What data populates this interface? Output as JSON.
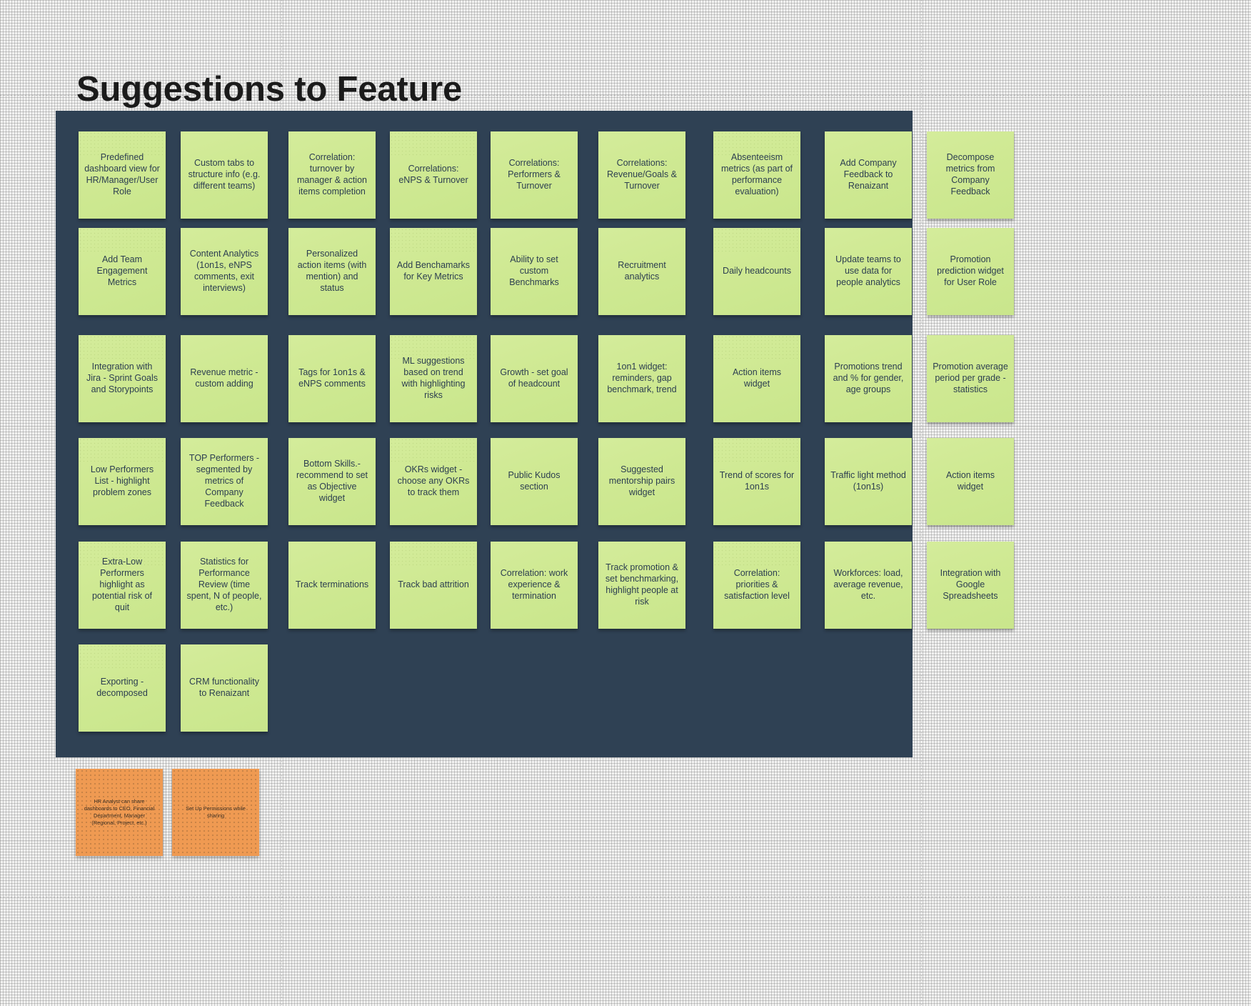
{
  "page": {
    "title": "Suggestions to Feature",
    "board_color": "#2f4154",
    "canvas_color": "#f2f2f1",
    "green_note_color": "#cde88e",
    "orange_note_color": "#ef9a52"
  },
  "board": {
    "columns": 9,
    "rows": 6,
    "notes": [
      {
        "text": "Predefined dashboard view for HR/Manager/User Role",
        "color": "green",
        "row": 1,
        "col": 1
      },
      {
        "text": "Custom tabs to structure info (e.g. different teams)",
        "color": "green",
        "row": 1,
        "col": 2
      },
      {
        "text": "Correlation: turnover by manager & action items completion",
        "color": "green",
        "row": 1,
        "col": 3
      },
      {
        "text": "Correlations: eNPS & Turnover",
        "color": "green",
        "row": 1,
        "col": 4
      },
      {
        "text": "Correlations: Performers & Turnover",
        "color": "green",
        "row": 1,
        "col": 5
      },
      {
        "text": "Correlations: Revenue/Goals & Turnover",
        "color": "green",
        "row": 1,
        "col": 6
      },
      {
        "text": "Absenteeism metrics (as part of performance evaluation)",
        "color": "green",
        "row": 1,
        "col": 7
      },
      {
        "text": "Add Company Feedback to Renaizant",
        "color": "green",
        "row": 1,
        "col": 8
      },
      {
        "text": "Decompose metrics from Company Feedback",
        "color": "green",
        "row": 1,
        "col": 9
      },
      {
        "text": "Add Team Engagement Metrics",
        "color": "green",
        "row": 2,
        "col": 1
      },
      {
        "text": "Content Analytics (1on1s, eNPS comments, exit interviews)",
        "color": "green",
        "row": 2,
        "col": 2
      },
      {
        "text": "Personalized action items (with mention) and status",
        "color": "green",
        "row": 2,
        "col": 3
      },
      {
        "text": "Add Benchamarks for Key Metrics",
        "color": "green",
        "row": 2,
        "col": 4
      },
      {
        "text": "Ability to set custom Benchmarks",
        "color": "green",
        "row": 2,
        "col": 5
      },
      {
        "text": "Recruitment analytics",
        "color": "green",
        "row": 2,
        "col": 6
      },
      {
        "text": "Daily headcounts",
        "color": "green",
        "row": 2,
        "col": 7
      },
      {
        "text": "Update teams to use data for people analytics",
        "color": "green",
        "row": 2,
        "col": 8
      },
      {
        "text": "Promotion prediction widget for User Role",
        "color": "green",
        "row": 2,
        "col": 9
      },
      {
        "text": "Integration with Jira - Sprint Goals and Storypoints",
        "color": "green",
        "row": 3,
        "col": 1
      },
      {
        "text": "Revenue metric - custom adding",
        "color": "green",
        "row": 3,
        "col": 2
      },
      {
        "text": "Tags for 1on1s & eNPS comments",
        "color": "green",
        "row": 3,
        "col": 3
      },
      {
        "text": "ML suggestions based on trend with highlighting risks",
        "color": "green",
        "row": 3,
        "col": 4
      },
      {
        "text": "Growth - set goal of headcount",
        "color": "green",
        "row": 3,
        "col": 5
      },
      {
        "text": "1on1 widget: reminders, gap benchmark, trend",
        "color": "green",
        "row": 3,
        "col": 6
      },
      {
        "text": "Action items widget",
        "color": "green",
        "row": 3,
        "col": 7
      },
      {
        "text": "Promotions trend and % for gender, age groups",
        "color": "green",
        "row": 3,
        "col": 8
      },
      {
        "text": "Promotion average period per grade - statistics",
        "color": "green",
        "row": 3,
        "col": 9
      },
      {
        "text": "Low Performers List - highlight problem zones",
        "color": "green",
        "row": 4,
        "col": 1
      },
      {
        "text": "TOP Performers - segmented by metrics of Company Feedback",
        "color": "green",
        "row": 4,
        "col": 2
      },
      {
        "text": "Bottom Skills.- recommend to set as Objective widget",
        "color": "green",
        "row": 4,
        "col": 3
      },
      {
        "text": "OKRs widget - choose any OKRs to track them",
        "color": "green",
        "row": 4,
        "col": 4
      },
      {
        "text": "Public Kudos section",
        "color": "green",
        "row": 4,
        "col": 5
      },
      {
        "text": "Suggested mentorship pairs widget",
        "color": "green",
        "row": 4,
        "col": 6
      },
      {
        "text": "Trend of scores for 1on1s",
        "color": "green",
        "row": 4,
        "col": 7
      },
      {
        "text": "Traffic light method (1on1s)",
        "color": "green",
        "row": 4,
        "col": 8
      },
      {
        "text": "Action items widget",
        "color": "green",
        "row": 4,
        "col": 9
      },
      {
        "text": "Extra-Low Performers highlight as potential risk of quit",
        "color": "green",
        "row": 5,
        "col": 1
      },
      {
        "text": "Statistics for Performance Review (time spent, N of people, etc.)",
        "color": "green",
        "row": 5,
        "col": 2
      },
      {
        "text": "Track terminations",
        "color": "green",
        "row": 5,
        "col": 3
      },
      {
        "text": "Track bad attrition",
        "color": "green",
        "row": 5,
        "col": 4
      },
      {
        "text": "Correlation: work experience & termination",
        "color": "green",
        "row": 5,
        "col": 5
      },
      {
        "text": "Track promotion & set benchmarking, highlight people at risk",
        "color": "green",
        "row": 5,
        "col": 6
      },
      {
        "text": "Correlation: priorities & satisfaction level",
        "color": "green",
        "row": 5,
        "col": 7
      },
      {
        "text": "Workforces: load, average revenue, etc.",
        "color": "green",
        "row": 5,
        "col": 8
      },
      {
        "text": "Integration with Google Spreadsheets",
        "color": "green",
        "row": 5,
        "col": 9
      },
      {
        "text": "Exporting - decomposed",
        "color": "green",
        "row": 6,
        "col": 1
      },
      {
        "text": "CRM functionality to Renaizant",
        "color": "green",
        "row": 6,
        "col": 2
      }
    ]
  },
  "loose_notes": [
    {
      "text": "HR Analyst can share dashboards to CEO, Financial Department, Manager (Regional, Project, etc.)",
      "color": "orange"
    },
    {
      "text": "Set Up Permissions while sharing",
      "color": "orange"
    }
  ]
}
